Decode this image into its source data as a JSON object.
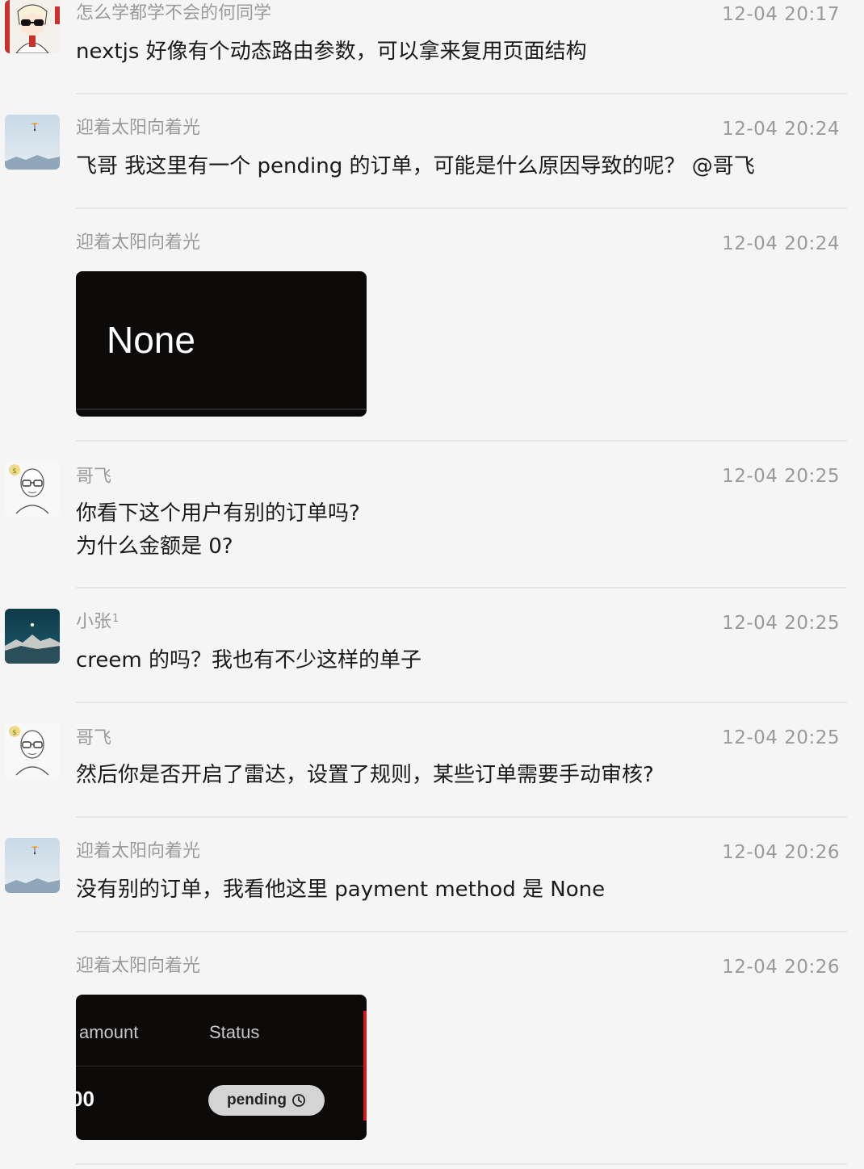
{
  "messages": [
    {
      "sender": "怎么学都学不会的何同学",
      "time": "12-04 20:17",
      "lines": [
        "nextjs 好像有个动态路由参数，可以拿来复用页面结构"
      ]
    },
    {
      "sender": "迎着太阳向着光",
      "time": "12-04 20:24",
      "lines": [
        "飞哥 我这里有一个 pending 的订单，可能是什么原因导致的呢？    @哥飞"
      ]
    },
    {
      "sender": "迎着太阳向着光",
      "time": "12-04 20:24",
      "image_text": "None"
    },
    {
      "sender": "哥飞",
      "time": "12-04 20:25",
      "lines": [
        "你看下这个用户有别的订单吗?",
        "为什么金额是 0?"
      ]
    },
    {
      "sender": "小张",
      "sender_sup": "1",
      "time": "12-04 20:25",
      "lines": [
        "creem 的吗？我也有不少这样的单子"
      ]
    },
    {
      "sender": "哥飞",
      "time": "12-04 20:25",
      "lines": [
        "然后你是否开启了雷达，设置了规则，某些订单需要手动审核?"
      ]
    },
    {
      "sender": "迎着太阳向着光",
      "time": "12-04 20:26",
      "lines": [
        "没有别的订单，我看他这里 payment method 是 None"
      ]
    },
    {
      "sender": "迎着太阳向着光",
      "time": "12-04 20:26",
      "table_image": {
        "col_amount": "amount",
        "col_status": "Status",
        "amount_value": "00",
        "status_value": "pending"
      }
    }
  ]
}
